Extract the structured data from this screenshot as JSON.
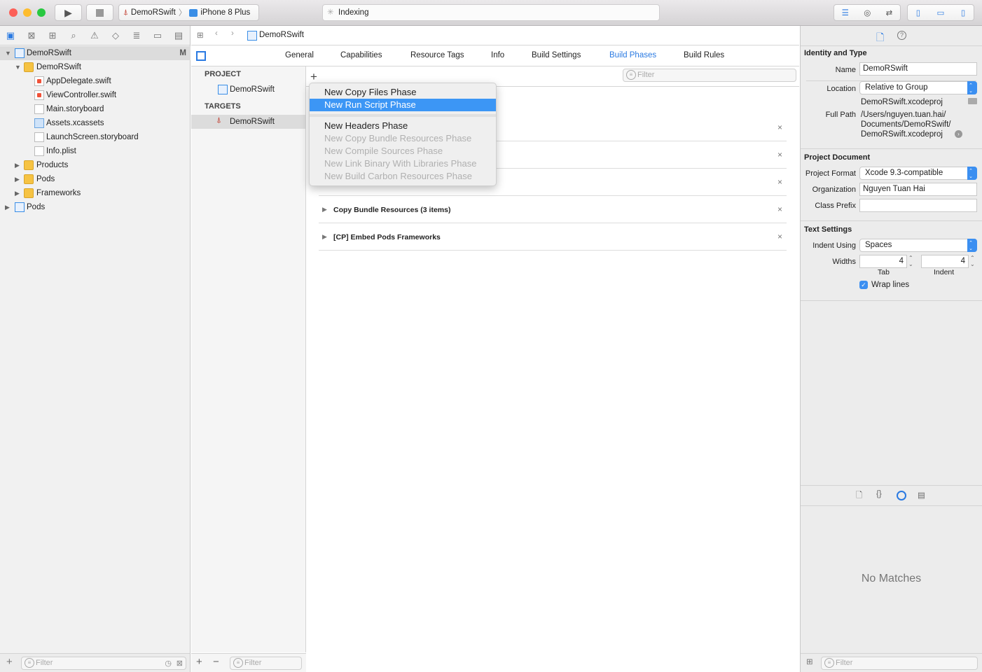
{
  "toolbar": {
    "scheme": "DemoRSwift",
    "device": "iPhone 8 Plus",
    "activity": "Indexing"
  },
  "navigator": {
    "items": [
      {
        "label": "DemoRSwift",
        "badge": "M"
      },
      {
        "label": "DemoRSwift"
      },
      {
        "label": "AppDelegate.swift"
      },
      {
        "label": "ViewController.swift"
      },
      {
        "label": "Main.storyboard"
      },
      {
        "label": "Assets.xcassets"
      },
      {
        "label": "LaunchScreen.storyboard"
      },
      {
        "label": "Info.plist"
      },
      {
        "label": "Products"
      },
      {
        "label": "Pods"
      },
      {
        "label": "Frameworks"
      },
      {
        "label": "Pods"
      }
    ],
    "filter_placeholder": "Filter"
  },
  "editor": {
    "breadcrumb": "DemoRSwift",
    "tabs": [
      "General",
      "Capabilities",
      "Resource Tags",
      "Info",
      "Build Settings",
      "Build Phases",
      "Build Rules"
    ],
    "active_tab": "Build Phases",
    "project_header": "PROJECT",
    "project_item": "DemoRSwift",
    "targets_header": "TARGETS",
    "target_item": "DemoRSwift",
    "filter_placeholder": "Filter",
    "list_filter_placeholder": "Filter",
    "phases": [
      "Copy Bundle Resources (3 items)",
      "[CP] Embed Pods Frameworks"
    ],
    "add_menu": [
      "New Copy Files Phase",
      "New Run Script Phase",
      "New Headers Phase",
      "New Copy Bundle Resources Phase",
      "New Compile Sources Phase",
      "New Link Binary With Libraries Phase",
      "New Build Carbon Resources Phase"
    ]
  },
  "inspector": {
    "identity": {
      "title": "Identity and Type",
      "name_label": "Name",
      "name": "DemoRSwift",
      "location_label": "Location",
      "location": "Relative to Group",
      "file": "DemoRSwift.xcodeproj",
      "fullpath_label": "Full Path",
      "fullpath": [
        "/Users/nguyen.tuan.hai/",
        "Documents/DemoRSwift/",
        "DemoRSwift.xcodeproj"
      ]
    },
    "project": {
      "title": "Project Document",
      "format_label": "Project Format",
      "format": "Xcode 9.3-compatible",
      "org_label": "Organization",
      "org": "Nguyen Tuan Hai",
      "prefix_label": "Class Prefix",
      "prefix": ""
    },
    "text": {
      "title": "Text Settings",
      "indent_label": "Indent Using",
      "indent": "Spaces",
      "widths_label": "Widths",
      "tab": "4",
      "indentw": "4",
      "tab_label": "Tab",
      "indent_sub": "Indent",
      "wrap": "Wrap lines"
    },
    "library_empty": "No Matches",
    "filter_placeholder": "Filter"
  },
  "colors": {
    "accent": "#3c96f5"
  }
}
